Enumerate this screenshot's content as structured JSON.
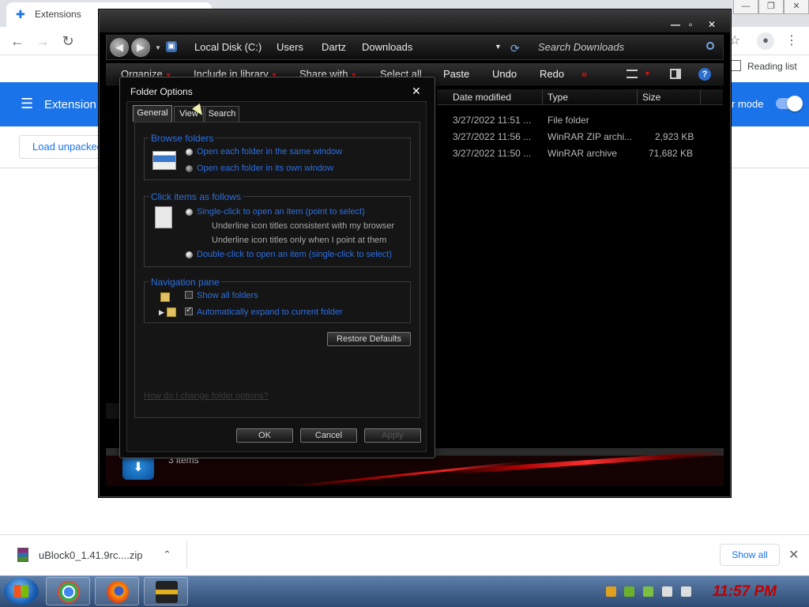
{
  "browser": {
    "tab_title": "Extensions",
    "reading_list": "Reading list",
    "page_title": "Extension",
    "dev_mode": "r mode",
    "load_unpacked": "Load unpacked"
  },
  "explorer": {
    "breadcrumbs": [
      "Local Disk (C:)",
      "Users",
      "Dartz",
      "Downloads"
    ],
    "search_placeholder": "Search Downloads",
    "toolbar": {
      "organize": "Organize",
      "include_in_library": "Include in library",
      "share_with": "Share with",
      "select_all": "Select all",
      "paste": "Paste",
      "undo": "Undo",
      "redo": "Redo",
      "more": "»"
    },
    "columns": {
      "date": "Date modified",
      "type": "Type",
      "size": "Size"
    },
    "rows": [
      {
        "date": "3/27/2022 11:51 ...",
        "type": "File folder",
        "size": ""
      },
      {
        "date": "3/27/2022 11:56 ...",
        "type": "WinRAR ZIP archi...",
        "size": "2,923 KB"
      },
      {
        "date": "3/27/2022 11:50 ...",
        "type": "WinRAR archive",
        "size": "71,682 KB"
      }
    ],
    "status": "3 items"
  },
  "dialog": {
    "title": "Folder Options",
    "tabs": [
      "General",
      "View",
      "Search"
    ],
    "browse_folders": {
      "legend": "Browse folders",
      "opt1": "Open each folder in the same window",
      "opt2": "Open each folder in its own window"
    },
    "click_items": {
      "legend": "Click items as follows",
      "opt1": "Single-click to open an item (point to select)",
      "sub1": "Underline icon titles consistent with my browser",
      "sub2": "Underline icon titles only when I point at them",
      "opt2": "Double-click to open an item (single-click to select)"
    },
    "nav_pane": {
      "legend": "Navigation pane",
      "opt1": "Show all folders",
      "opt2": "Automatically expand to current folder"
    },
    "restore_defaults": "Restore Defaults",
    "help_link": "How do I change folder options?",
    "ok": "OK",
    "cancel": "Cancel",
    "apply": "Apply"
  },
  "download_shelf": {
    "file": "uBlock0_1.41.9rc....zip",
    "show_all": "Show all"
  },
  "taskbar": {
    "clock": "11:57 PM"
  }
}
